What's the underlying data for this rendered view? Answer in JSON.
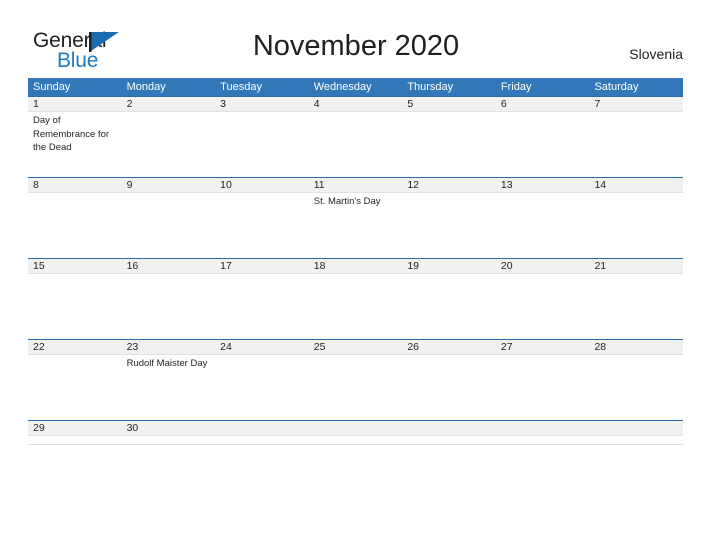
{
  "brand": {
    "name_part1": "General",
    "name_part2": "Blue",
    "flag_icon": "blue-triangle-flag-icon",
    "accent_color": "#1f7ac4"
  },
  "header": {
    "title": "November 2020",
    "country": "Slovenia"
  },
  "theme": {
    "header_blue": "#3278b8",
    "row_rule_blue": "#2d6ca8",
    "daynum_strip_gray": "#f1f1f1",
    "text_color": "#231f20",
    "page_background": "#ffffff"
  },
  "calendar": {
    "weekdays": [
      "Sunday",
      "Monday",
      "Tuesday",
      "Wednesday",
      "Thursday",
      "Friday",
      "Saturday"
    ],
    "weeks": [
      {
        "days": [
          {
            "date": "1",
            "event": "Day of Remembrance for the Dead"
          },
          {
            "date": "2",
            "event": ""
          },
          {
            "date": "3",
            "event": ""
          },
          {
            "date": "4",
            "event": ""
          },
          {
            "date": "5",
            "event": ""
          },
          {
            "date": "6",
            "event": ""
          },
          {
            "date": "7",
            "event": ""
          }
        ]
      },
      {
        "days": [
          {
            "date": "8",
            "event": ""
          },
          {
            "date": "9",
            "event": ""
          },
          {
            "date": "10",
            "event": ""
          },
          {
            "date": "11",
            "event": "St. Martin's Day"
          },
          {
            "date": "12",
            "event": ""
          },
          {
            "date": "13",
            "event": ""
          },
          {
            "date": "14",
            "event": ""
          }
        ]
      },
      {
        "days": [
          {
            "date": "15",
            "event": ""
          },
          {
            "date": "16",
            "event": ""
          },
          {
            "date": "17",
            "event": ""
          },
          {
            "date": "18",
            "event": ""
          },
          {
            "date": "19",
            "event": ""
          },
          {
            "date": "20",
            "event": ""
          },
          {
            "date": "21",
            "event": ""
          }
        ]
      },
      {
        "days": [
          {
            "date": "22",
            "event": ""
          },
          {
            "date": "23",
            "event": "Rudolf Maister Day"
          },
          {
            "date": "24",
            "event": ""
          },
          {
            "date": "25",
            "event": ""
          },
          {
            "date": "26",
            "event": ""
          },
          {
            "date": "27",
            "event": ""
          },
          {
            "date": "28",
            "event": ""
          }
        ]
      },
      {
        "days": [
          {
            "date": "29",
            "event": ""
          },
          {
            "date": "30",
            "event": ""
          },
          {
            "date": "",
            "event": ""
          },
          {
            "date": "",
            "event": ""
          },
          {
            "date": "",
            "event": ""
          },
          {
            "date": "",
            "event": ""
          },
          {
            "date": "",
            "event": ""
          }
        ]
      }
    ]
  }
}
